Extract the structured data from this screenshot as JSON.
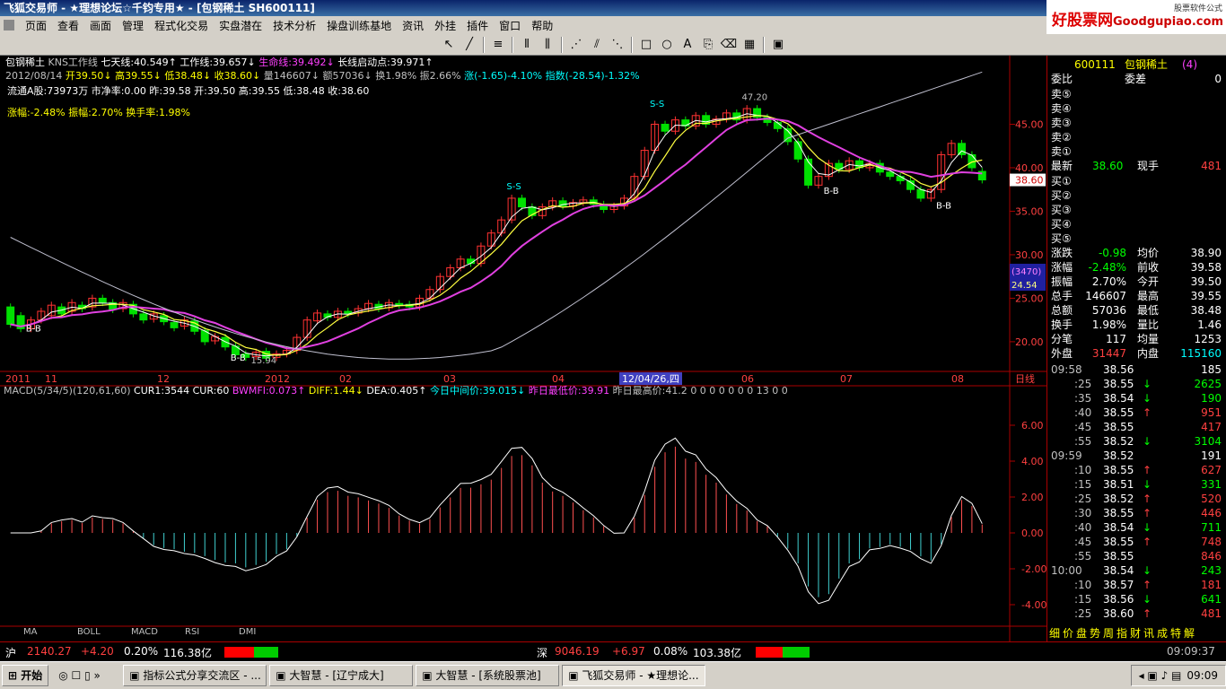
{
  "window": {
    "title": "飞狐交易师 - ★理想论坛☆千钧专用★ - [包钢稀土 SH600111]"
  },
  "menu": [
    "页面",
    "查看",
    "画面",
    "管理",
    "程式化交易",
    "实盘潜在",
    "技术分析",
    "操盘训练基地",
    "资讯",
    "外挂",
    "插件",
    "窗口",
    "帮助"
  ],
  "ad": {
    "brand": "好股票网",
    "domain": "Goodgupiao.com",
    "tag": "股票软件公式"
  },
  "header": {
    "line1": [
      {
        "t": "包钢稀土",
        "c": "wht"
      },
      {
        "t": "KNS工作线",
        "c": "gray"
      },
      {
        "t": "七天线:40.549↑",
        "c": "wht"
      },
      {
        "t": "工作线:39.657↓",
        "c": "wht"
      },
      {
        "t": "生命线:39.492↓",
        "c": "mag"
      },
      {
        "t": "长线启动点:39.971↑",
        "c": "wht"
      }
    ],
    "line2": [
      {
        "t": "2012/08/14",
        "c": "gray"
      },
      {
        "t": "开39.50↓",
        "c": "yel"
      },
      {
        "t": "高39.55↓",
        "c": "yel"
      },
      {
        "t": "低38.48↓",
        "c": "yel"
      },
      {
        "t": "收38.60↓",
        "c": "yel"
      },
      {
        "t": "量146607↓",
        "c": "gray"
      },
      {
        "t": "额57036↓",
        "c": "gray"
      },
      {
        "t": "换1.98%",
        "c": "gray"
      },
      {
        "t": "振2.66%",
        "c": "gray"
      },
      {
        "t": "涨(-1.65)-4.10%",
        "c": "cyan"
      },
      {
        "t": "指数(-28.54)-1.32%",
        "c": "cyan"
      }
    ],
    "line3": "流通A股:73973万 市净率:0.00 昨:39.58 开:39.50 高:39.55 低:38.48 收:38.60",
    "line4": "涨幅:-2.48% 振幅:2.70% 换手率:1.98%"
  },
  "price_axis": [
    "45.00",
    "40.00",
    "35.00",
    "30.00",
    "25.00",
    "20.00"
  ],
  "price_tag": "38.60",
  "box": {
    "l1": "(3470)",
    "l2": "24.54"
  },
  "annotations": {
    "peak": "47.20",
    "low": "15.94",
    "ss": "S-S",
    "bb": "B-B"
  },
  "date_axis": [
    "2011",
    "11",
    "12",
    "2012",
    "02",
    "03",
    "04",
    "05",
    "06",
    "07",
    "08"
  ],
  "date_cursor": "12/04/26,四",
  "period": "日线",
  "macd_header": [
    {
      "t": "MACD(5/34/5)(120,61,60)",
      "c": "gray"
    },
    {
      "t": "CUR1:3544",
      "c": "wht"
    },
    {
      "t": "CUR:60",
      "c": "wht"
    },
    {
      "t": "BWMFI:0.073↑",
      "c": "mag"
    },
    {
      "t": "DIFF:1.44↓",
      "c": "yel"
    },
    {
      "t": "DEA:0.405↑",
      "c": "wht"
    },
    {
      "t": "今日中间价:39.015↓",
      "c": "cyan"
    },
    {
      "t": "昨日最低价:39.91",
      "c": "mag"
    },
    {
      "t": "昨日最高价:41.2",
      "c": "gray"
    },
    {
      "t": "0 0 0 0 0 0 0 13 0 0",
      "c": "gray"
    }
  ],
  "macd_axis": [
    "6.00",
    "4.00",
    "2.00",
    "0.00",
    "-2.00",
    "-4.00"
  ],
  "tabs": [
    "MA",
    "BOLL",
    "MACD",
    "RSI",
    "DMI"
  ],
  "quote": {
    "code": "600111",
    "name": "包钢稀土",
    "count": "(4)",
    "weibi": "委比",
    "weicha": "委差",
    "weicha_v": "0",
    "sells": [
      "卖⑤",
      "卖④",
      "卖③",
      "卖②",
      "卖①"
    ],
    "buys": [
      "买①",
      "买②",
      "买③",
      "买④",
      "买⑤"
    ],
    "latest_l": "最新",
    "latest": "38.60",
    "xianshou_l": "现手",
    "xianshou": "481",
    "stats": [
      [
        "涨跌",
        "-0.98",
        "均价",
        "38.90"
      ],
      [
        "涨幅",
        "-2.48%",
        "前收",
        "39.58"
      ],
      [
        "振幅",
        "2.70%",
        "今开",
        "39.50"
      ],
      [
        "总手",
        "146607",
        "最高",
        "39.55"
      ],
      [
        "总额",
        "57036",
        "最低",
        "38.48"
      ],
      [
        "换手",
        "1.98%",
        "量比",
        "1.46"
      ],
      [
        "分笔",
        "117",
        "均量",
        "1253"
      ],
      [
        "外盘",
        "31447",
        "内盘",
        "115160"
      ]
    ],
    "ticks": [
      [
        "09:58",
        "38.56",
        "",
        "185",
        "w"
      ],
      [
        ":25",
        "38.55",
        "↓",
        "2625",
        "g"
      ],
      [
        ":35",
        "38.54",
        "↓",
        "190",
        "g"
      ],
      [
        ":40",
        "38.55",
        "↑",
        "951",
        "r"
      ],
      [
        ":45",
        "38.55",
        "",
        "417",
        "r"
      ],
      [
        ":55",
        "38.52",
        "↓",
        "3104",
        "g"
      ],
      [
        "09:59",
        "38.52",
        "",
        "191",
        "w"
      ],
      [
        ":10",
        "38.55",
        "↑",
        "627",
        "r"
      ],
      [
        ":15",
        "38.51",
        "↓",
        "331",
        "g"
      ],
      [
        ":25",
        "38.52",
        "↑",
        "520",
        "r"
      ],
      [
        ":30",
        "38.55",
        "↑",
        "446",
        "r"
      ],
      [
        ":40",
        "38.54",
        "↓",
        "711",
        "g"
      ],
      [
        ":45",
        "38.55",
        "↑",
        "748",
        "r"
      ],
      [
        ":55",
        "38.55",
        "",
        "846",
        "r"
      ],
      [
        "10:00",
        "38.54",
        "↓",
        "243",
        "g"
      ],
      [
        ":10",
        "38.57",
        "↑",
        "181",
        "r"
      ],
      [
        ":15",
        "38.56",
        "↓",
        "641",
        "g"
      ],
      [
        ":25",
        "38.60",
        "↑",
        "481",
        "r"
      ]
    ],
    "bottom_tabs": "细价盘势周指财讯成特解"
  },
  "status": {
    "sh_l": "沪",
    "sh_v": "2140.27",
    "sh_c": "+4.20",
    "sh_p": "0.20%",
    "sh_a": "116.38亿",
    "sz_l": "深",
    "sz_v": "9046.19",
    "sz_c": "+6.97",
    "sz_p": "0.08%",
    "sz_a": "103.38亿",
    "time": "09:09:37"
  },
  "taskbar": {
    "start": "开始",
    "items": [
      "指标公式分享交流区 - ...",
      "大智慧 - [辽宁成大]",
      "大智慧 - [系统股票池]",
      "飞狐交易师 - ★理想论..."
    ],
    "clock": "09:09"
  },
  "chart_data": {
    "type": "candlestick",
    "ylim": [
      17,
      50
    ],
    "candles": [
      [
        24,
        22
      ],
      [
        23,
        21.5
      ],
      [
        21.5,
        22.5
      ],
      [
        22.5,
        23.5
      ],
      [
        23,
        24.2
      ],
      [
        24,
        23.2
      ],
      [
        23.5,
        24.5
      ],
      [
        24.2,
        23.8
      ],
      [
        24,
        25
      ],
      [
        25,
        24.5
      ],
      [
        24.5,
        23.7
      ],
      [
        23.8,
        24.5
      ],
      [
        24.3,
        23.2
      ],
      [
        23.2,
        22.5
      ],
      [
        22.6,
        23.2
      ],
      [
        23,
        22.3
      ],
      [
        22.2,
        21.6
      ],
      [
        21.8,
        22.5
      ],
      [
        22.4,
        21.2
      ],
      [
        21.3,
        20
      ],
      [
        20.1,
        20.6
      ],
      [
        20.5,
        19.4
      ],
      [
        19.5,
        18.5
      ],
      [
        18.6,
        18.2
      ],
      [
        18.3,
        18.8
      ],
      [
        18.9,
        18.1
      ],
      [
        18.2,
        18.6
      ],
      [
        18.6,
        19
      ],
      [
        19,
        20.5
      ],
      [
        20.5,
        22.5
      ],
      [
        22.4,
        23.3
      ],
      [
        23.2,
        22.8
      ],
      [
        22.8,
        23.5
      ],
      [
        23.5,
        23.2
      ],
      [
        23.3,
        23.8
      ],
      [
        23.8,
        24.4
      ],
      [
        24.3,
        23.8
      ],
      [
        23.9,
        24.5
      ],
      [
        24.4,
        24.2
      ],
      [
        24.3,
        24
      ],
      [
        24,
        25
      ],
      [
        25,
        26
      ],
      [
        26,
        27.5
      ],
      [
        27.5,
        28.5
      ],
      [
        28.5,
        29.5
      ],
      [
        29.5,
        29
      ],
      [
        29,
        31
      ],
      [
        31,
        32.5
      ],
      [
        32.5,
        34
      ],
      [
        34,
        36.5
      ],
      [
        36.5,
        35.5
      ],
      [
        35.5,
        34.5
      ],
      [
        34.5,
        35.5
      ],
      [
        35.5,
        36.2
      ],
      [
        36.2,
        35.6
      ],
      [
        35.6,
        36
      ],
      [
        36,
        36.3
      ],
      [
        36.3,
        35.8
      ],
      [
        35.8,
        35.2
      ],
      [
        35.2,
        35.6
      ],
      [
        35.6,
        36.5
      ],
      [
        36.5,
        39
      ],
      [
        39,
        42
      ],
      [
        42,
        45
      ],
      [
        45,
        44.2
      ],
      [
        44.2,
        45.5
      ],
      [
        45.5,
        44.8
      ],
      [
        44.8,
        46
      ],
      [
        46,
        45
      ],
      [
        45,
        45.6
      ],
      [
        45.6,
        46.3
      ],
      [
        46.3,
        45.5
      ],
      [
        45.5,
        46.8
      ],
      [
        46.8,
        45.8
      ],
      [
        45.8,
        45.2
      ],
      [
        45.2,
        44.5
      ],
      [
        44.5,
        43
      ],
      [
        43,
        41
      ],
      [
        41,
        38
      ],
      [
        38,
        39
      ],
      [
        39,
        40.5
      ],
      [
        40.5,
        39.8
      ],
      [
        39.8,
        40.8
      ],
      [
        40.8,
        40
      ],
      [
        40,
        40.5
      ],
      [
        40.5,
        39.5
      ],
      [
        39.5,
        39
      ],
      [
        39,
        38.5
      ],
      [
        38.5,
        37.5
      ],
      [
        37.5,
        36.5
      ],
      [
        36.5,
        37.5
      ],
      [
        37.5,
        41.5
      ],
      [
        41.5,
        42.8
      ],
      [
        42.8,
        41.5
      ],
      [
        41.5,
        40
      ],
      [
        39.58,
        38.6
      ]
    ]
  }
}
